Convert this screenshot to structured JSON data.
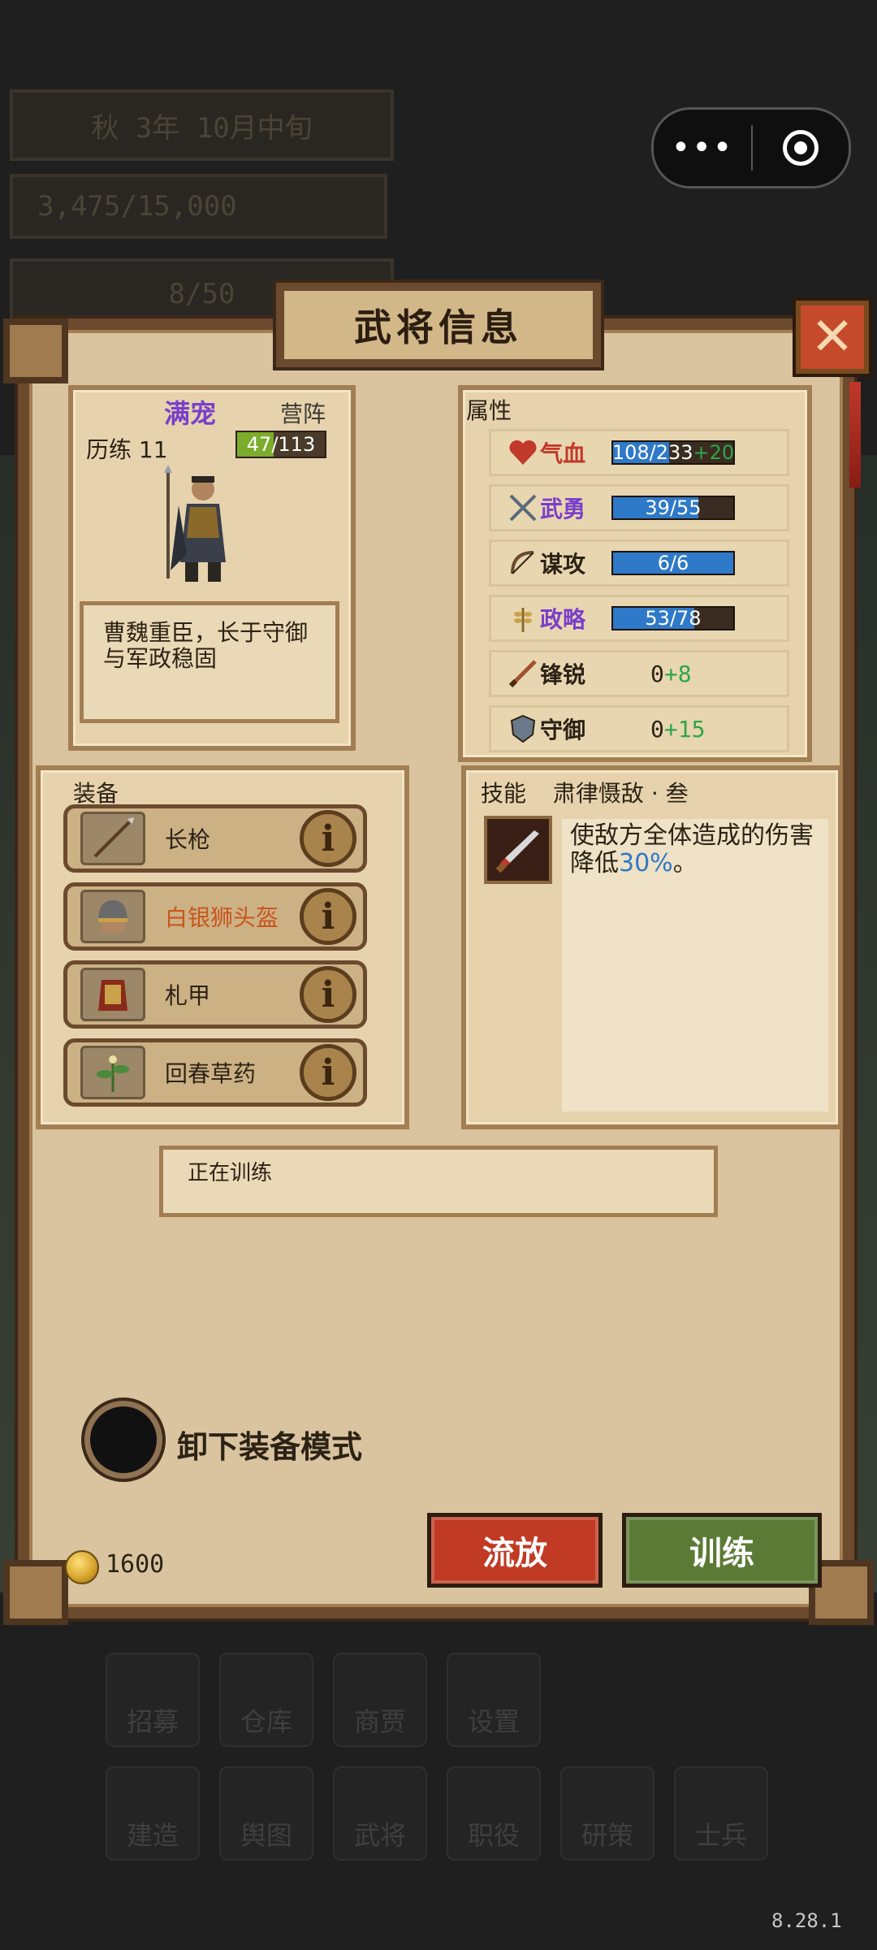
{
  "hud": {
    "season": "秋 3年 10月中旬",
    "gold": "3,475/15,000",
    "troops": "8/50"
  },
  "capsule": {
    "more": "•••"
  },
  "panel": {
    "title": "武将信息",
    "close": "✕"
  },
  "general": {
    "name": "满宠",
    "camp": "营阵",
    "exp_label": "历练 11",
    "exp_text": "47/113",
    "exp_progress": 0.416,
    "description": "曹魏重臣，长于守御与军政稳固"
  },
  "attributes": {
    "title": "属性",
    "rows": [
      {
        "name": "气血",
        "value": "108/233",
        "bonus": "+20",
        "progress": 0.464,
        "color": "#c0392b",
        "icon": "heart-icon"
      },
      {
        "name": "武勇",
        "value": "39/55",
        "progress": 0.709,
        "color": "#7a3fc9",
        "icon": "swords-icon"
      },
      {
        "name": "谋攻",
        "value": "6/6",
        "progress": 1.0,
        "color": "#2c2215",
        "icon": "bow-icon"
      },
      {
        "name": "政略",
        "value": "53/78",
        "progress": 0.679,
        "color": "#7a3fc9",
        "icon": "wheat-icon"
      },
      {
        "name": "锋锐",
        "value": "0",
        "bonus": "+8",
        "color": "#2c2215",
        "icon": "sword-icon"
      },
      {
        "name": "守御",
        "value": "0",
        "bonus": "+15",
        "color": "#2c2215",
        "icon": "shield-icon"
      }
    ]
  },
  "equipment": {
    "title": "装备",
    "items": [
      {
        "name": "长枪",
        "color": "#2c2215",
        "icon": "spear-icon"
      },
      {
        "name": "白银狮头盔",
        "color": "#c9561e",
        "icon": "helmet-icon"
      },
      {
        "name": "札甲",
        "color": "#2c2215",
        "icon": "armor-icon"
      },
      {
        "name": "回春草药",
        "color": "#2c2215",
        "icon": "herb-icon"
      }
    ],
    "info": "i"
  },
  "skill": {
    "label": "技能",
    "name": "肃律慑敌 · 叁",
    "desc_before": "使敌方全体造成的伤害降低",
    "desc_highlight": "30%",
    "desc_after": "。"
  },
  "status": "正在训练",
  "unequip_mode": "卸下装备模式",
  "coins": "1600",
  "buttons": {
    "exile": "流放",
    "train": "训练"
  },
  "bottom_menu": [
    "招募",
    "仓库",
    "商贾",
    "设置",
    "建造",
    "舆图",
    "武将",
    "职役",
    "研策",
    "士兵"
  ],
  "version": "8.28.1"
}
